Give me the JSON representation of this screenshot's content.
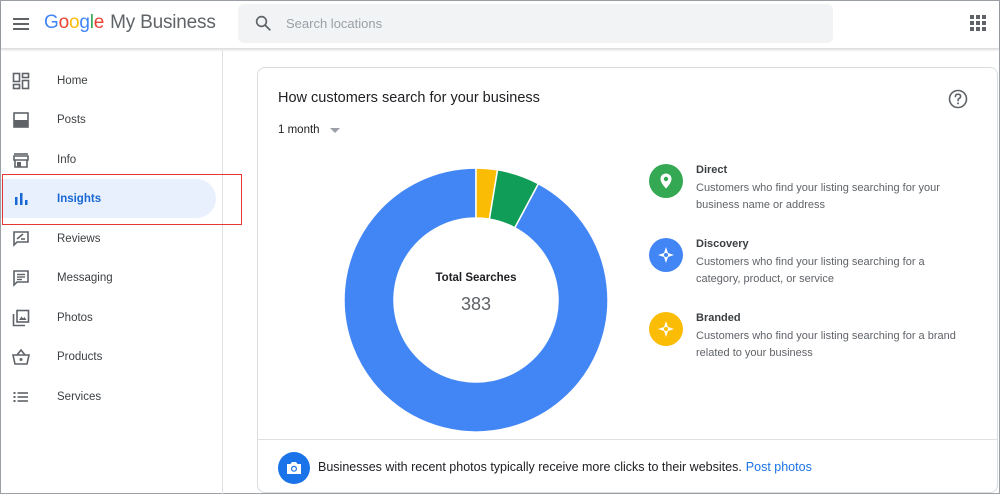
{
  "header": {
    "logo_google": [
      "G",
      "o",
      "o",
      "g",
      "l",
      "e"
    ],
    "logo_product": "My Business",
    "search_placeholder": "Search locations"
  },
  "sidebar": {
    "items": [
      {
        "label": "Home",
        "icon": "dashboard-icon"
      },
      {
        "label": "Posts",
        "icon": "posts-icon"
      },
      {
        "label": "Info",
        "icon": "store-icon"
      },
      {
        "label": "Insights",
        "icon": "bar-chart-icon",
        "active": true
      },
      {
        "label": "Reviews",
        "icon": "rate-review-icon"
      },
      {
        "label": "Messaging",
        "icon": "message-icon"
      },
      {
        "label": "Photos",
        "icon": "photo-library-icon"
      },
      {
        "label": "Products",
        "icon": "shopping-basket-icon"
      },
      {
        "label": "Services",
        "icon": "list-icon"
      }
    ]
  },
  "card": {
    "title": "How customers search for your business",
    "period": "1 month",
    "center_label": "Total Searches",
    "center_value": "383",
    "legend": [
      {
        "title": "Direct",
        "desc": "Customers who find your listing searching for your business name or address",
        "color": "#34a853",
        "icon": "location-pin-icon"
      },
      {
        "title": "Discovery",
        "desc": "Customers who find your listing searching for a category, product, or service",
        "color": "#4285f4",
        "icon": "compass-icon"
      },
      {
        "title": "Branded",
        "desc": "Customers who find your listing searching for a brand related to your business",
        "color": "#fbbc05",
        "icon": "compass-icon"
      }
    ],
    "footer_text": "Businesses with recent photos typically receive more clicks to their websites.",
    "footer_link": "Post photos"
  },
  "chart_data": {
    "type": "pie",
    "categories": [
      "Discovery",
      "Branded",
      "Direct"
    ],
    "values": [
      353,
      10,
      20
    ],
    "colors": [
      "#4285f4",
      "#fbbc05",
      "#0f9d58"
    ]
  }
}
